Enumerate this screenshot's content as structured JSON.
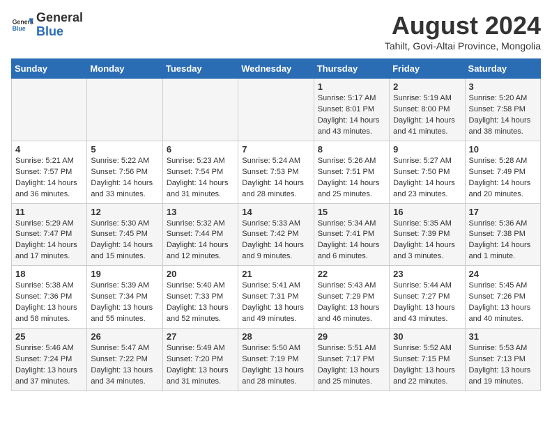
{
  "header": {
    "logo_general": "General",
    "logo_blue": "Blue",
    "month_year": "August 2024",
    "location": "Tahilt, Govi-Altai Province, Mongolia"
  },
  "days_of_week": [
    "Sunday",
    "Monday",
    "Tuesday",
    "Wednesday",
    "Thursday",
    "Friday",
    "Saturday"
  ],
  "weeks": [
    [
      {
        "day": "",
        "content": ""
      },
      {
        "day": "",
        "content": ""
      },
      {
        "day": "",
        "content": ""
      },
      {
        "day": "",
        "content": ""
      },
      {
        "day": "1",
        "content": "Sunrise: 5:17 AM\nSunset: 8:01 PM\nDaylight: 14 hours and 43 minutes."
      },
      {
        "day": "2",
        "content": "Sunrise: 5:19 AM\nSunset: 8:00 PM\nDaylight: 14 hours and 41 minutes."
      },
      {
        "day": "3",
        "content": "Sunrise: 5:20 AM\nSunset: 7:58 PM\nDaylight: 14 hours and 38 minutes."
      }
    ],
    [
      {
        "day": "4",
        "content": "Sunrise: 5:21 AM\nSunset: 7:57 PM\nDaylight: 14 hours and 36 minutes."
      },
      {
        "day": "5",
        "content": "Sunrise: 5:22 AM\nSunset: 7:56 PM\nDaylight: 14 hours and 33 minutes."
      },
      {
        "day": "6",
        "content": "Sunrise: 5:23 AM\nSunset: 7:54 PM\nDaylight: 14 hours and 31 minutes."
      },
      {
        "day": "7",
        "content": "Sunrise: 5:24 AM\nSunset: 7:53 PM\nDaylight: 14 hours and 28 minutes."
      },
      {
        "day": "8",
        "content": "Sunrise: 5:26 AM\nSunset: 7:51 PM\nDaylight: 14 hours and 25 minutes."
      },
      {
        "day": "9",
        "content": "Sunrise: 5:27 AM\nSunset: 7:50 PM\nDaylight: 14 hours and 23 minutes."
      },
      {
        "day": "10",
        "content": "Sunrise: 5:28 AM\nSunset: 7:49 PM\nDaylight: 14 hours and 20 minutes."
      }
    ],
    [
      {
        "day": "11",
        "content": "Sunrise: 5:29 AM\nSunset: 7:47 PM\nDaylight: 14 hours and 17 minutes."
      },
      {
        "day": "12",
        "content": "Sunrise: 5:30 AM\nSunset: 7:45 PM\nDaylight: 14 hours and 15 minutes."
      },
      {
        "day": "13",
        "content": "Sunrise: 5:32 AM\nSunset: 7:44 PM\nDaylight: 14 hours and 12 minutes."
      },
      {
        "day": "14",
        "content": "Sunrise: 5:33 AM\nSunset: 7:42 PM\nDaylight: 14 hours and 9 minutes."
      },
      {
        "day": "15",
        "content": "Sunrise: 5:34 AM\nSunset: 7:41 PM\nDaylight: 14 hours and 6 minutes."
      },
      {
        "day": "16",
        "content": "Sunrise: 5:35 AM\nSunset: 7:39 PM\nDaylight: 14 hours and 3 minutes."
      },
      {
        "day": "17",
        "content": "Sunrise: 5:36 AM\nSunset: 7:38 PM\nDaylight: 14 hours and 1 minute."
      }
    ],
    [
      {
        "day": "18",
        "content": "Sunrise: 5:38 AM\nSunset: 7:36 PM\nDaylight: 13 hours and 58 minutes."
      },
      {
        "day": "19",
        "content": "Sunrise: 5:39 AM\nSunset: 7:34 PM\nDaylight: 13 hours and 55 minutes."
      },
      {
        "day": "20",
        "content": "Sunrise: 5:40 AM\nSunset: 7:33 PM\nDaylight: 13 hours and 52 minutes."
      },
      {
        "day": "21",
        "content": "Sunrise: 5:41 AM\nSunset: 7:31 PM\nDaylight: 13 hours and 49 minutes."
      },
      {
        "day": "22",
        "content": "Sunrise: 5:43 AM\nSunset: 7:29 PM\nDaylight: 13 hours and 46 minutes."
      },
      {
        "day": "23",
        "content": "Sunrise: 5:44 AM\nSunset: 7:27 PM\nDaylight: 13 hours and 43 minutes."
      },
      {
        "day": "24",
        "content": "Sunrise: 5:45 AM\nSunset: 7:26 PM\nDaylight: 13 hours and 40 minutes."
      }
    ],
    [
      {
        "day": "25",
        "content": "Sunrise: 5:46 AM\nSunset: 7:24 PM\nDaylight: 13 hours and 37 minutes."
      },
      {
        "day": "26",
        "content": "Sunrise: 5:47 AM\nSunset: 7:22 PM\nDaylight: 13 hours and 34 minutes."
      },
      {
        "day": "27",
        "content": "Sunrise: 5:49 AM\nSunset: 7:20 PM\nDaylight: 13 hours and 31 minutes."
      },
      {
        "day": "28",
        "content": "Sunrise: 5:50 AM\nSunset: 7:19 PM\nDaylight: 13 hours and 28 minutes."
      },
      {
        "day": "29",
        "content": "Sunrise: 5:51 AM\nSunset: 7:17 PM\nDaylight: 13 hours and 25 minutes."
      },
      {
        "day": "30",
        "content": "Sunrise: 5:52 AM\nSunset: 7:15 PM\nDaylight: 13 hours and 22 minutes."
      },
      {
        "day": "31",
        "content": "Sunrise: 5:53 AM\nSunset: 7:13 PM\nDaylight: 13 hours and 19 minutes."
      }
    ]
  ]
}
